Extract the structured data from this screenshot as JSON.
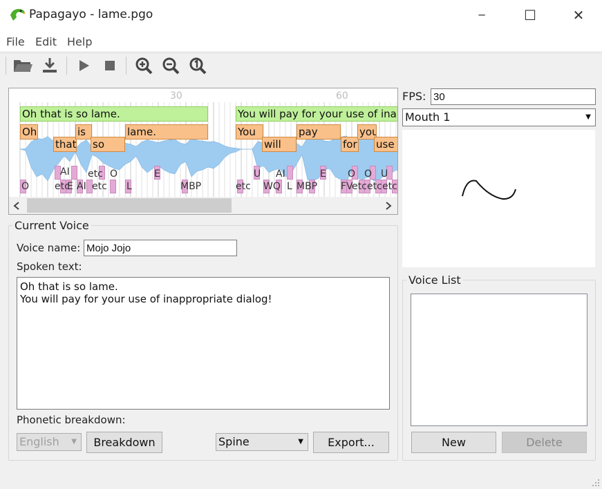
{
  "window": {
    "title": "Papagayo - lame.pgo",
    "minimize_glyph": "─",
    "maximize_glyph": "☐",
    "close_glyph": "✕"
  },
  "menu": {
    "file": "File",
    "edit": "Edit",
    "help": "Help"
  },
  "toolbar": {
    "icons": [
      "open-icon",
      "save-icon",
      "play-icon",
      "stop-icon",
      "zoom-in-icon",
      "zoom-out-icon",
      "zoom-reset-icon"
    ]
  },
  "timeline": {
    "ticks": [
      "30",
      "60"
    ],
    "phrases": [
      "Oh that is so lame.",
      "You will pay for your use of inappropriate dialog!"
    ],
    "words": [
      "Oh",
      "that",
      "is",
      "so",
      "lame.",
      "You",
      "will",
      "pay",
      "for",
      "you",
      "use"
    ],
    "phoneme_labels_top": [
      "AI",
      "etc",
      "O",
      "E",
      "U",
      "AI",
      "E",
      "O",
      "O",
      "U"
    ],
    "phoneme_labels_bottom": [
      "O",
      "etc",
      "E",
      "AI",
      "etc",
      "L",
      "MBP",
      "etc",
      "WQ",
      "L",
      "MBP",
      "FV",
      "etc",
      "etc",
      "etc"
    ]
  },
  "colors": {
    "phrase": "#bff09a",
    "word": "#f9c08a",
    "phoneme": "#e4aad6",
    "waveform": "#9ecbf0"
  },
  "right": {
    "fps_label": "FPS:",
    "fps_value": "30",
    "mouth_select": "Mouth 1"
  },
  "current_voice": {
    "legend": "Current Voice",
    "voice_name_label": "Voice name:",
    "voice_name_value": "Mojo Jojo",
    "spoken_text_label": "Spoken text:",
    "spoken_line1": "Oh that is so lame.",
    "spoken_line2": "You will pay for your use of inappropriate dialog!",
    "phonetic_label": "Phonetic breakdown:",
    "language_select": "English",
    "breakdown_button": "Breakdown",
    "export_format_select": "Spine",
    "export_button": "Export..."
  },
  "voice_list": {
    "legend": "Voice List",
    "new_button": "New",
    "delete_button": "Delete"
  }
}
